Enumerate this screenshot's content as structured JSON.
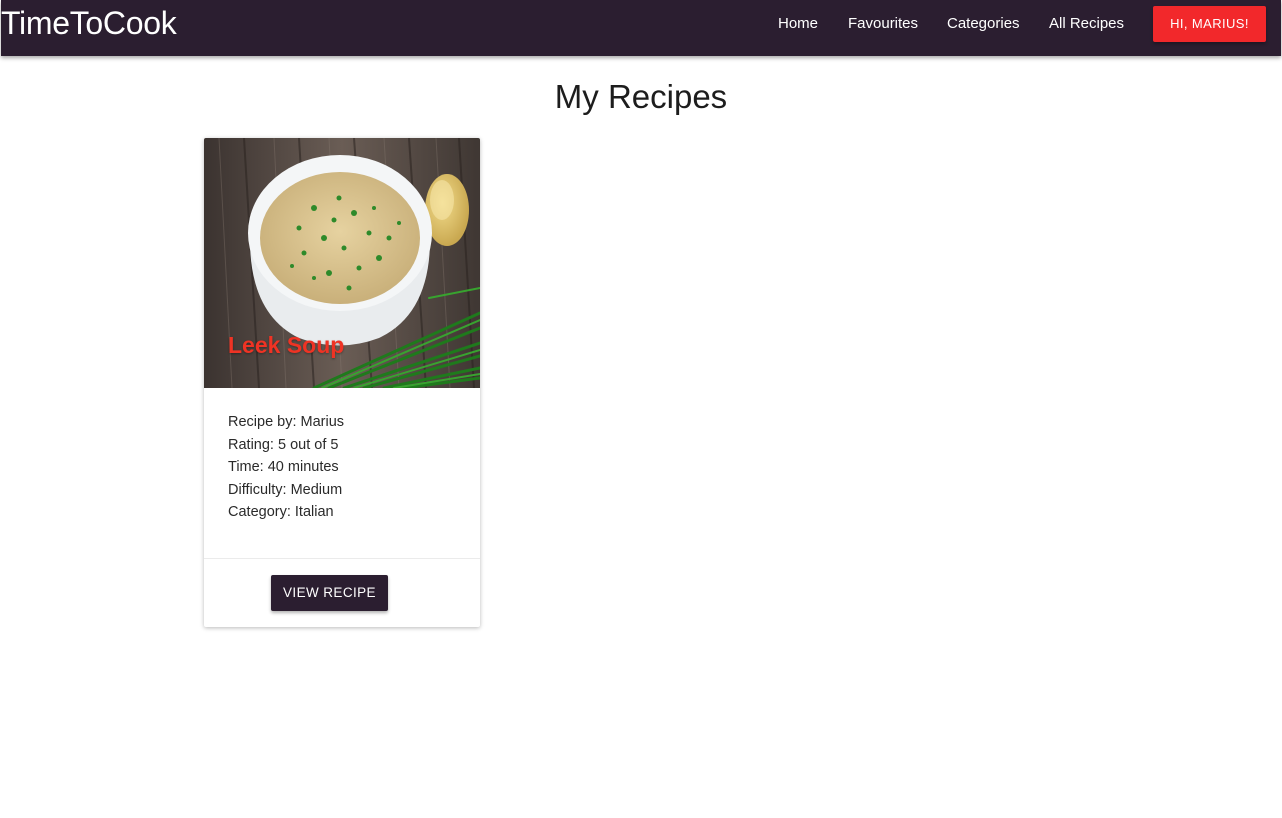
{
  "app": {
    "brand": "TimeToCook",
    "colors": {
      "navbar": "#2b1e30",
      "accent": "#f2282b",
      "card_title": "#ef3324"
    }
  },
  "nav": {
    "links": [
      {
        "label": "Home"
      },
      {
        "label": "Favourites"
      },
      {
        "label": "Categories"
      },
      {
        "label": "All Recipes"
      }
    ],
    "user_button": "HI, MARIUS!"
  },
  "page": {
    "title": "My Recipes"
  },
  "recipes": [
    {
      "title": "Leek Soup",
      "image_icon": "leek-soup-photo",
      "details": [
        "Recipe by: Marius",
        "Rating: 5 out of 5",
        "Time: 40 minutes",
        "Difficulty: Medium",
        "Category: Italian"
      ],
      "button": "VIEW RECIPE"
    }
  ]
}
